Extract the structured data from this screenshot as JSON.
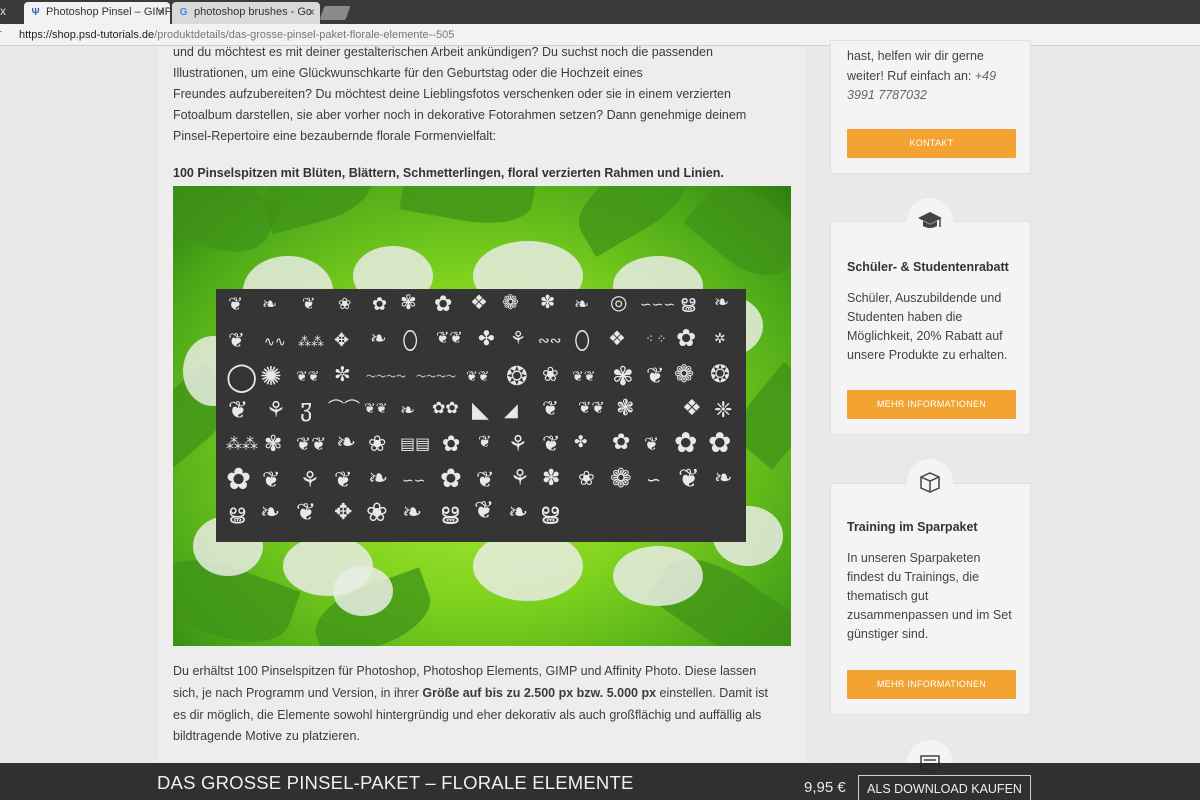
{
  "browser": {
    "tabs": [
      {
        "title": "Photoshop Pinsel – GIMP",
        "favicon": "psd-tutorials-favicon"
      },
      {
        "title": "photoshop brushes - Go",
        "favicon": "google-favicon"
      }
    ],
    "url_host": "https://shop.psd-tutorials.de",
    "url_path": "/produktdetails/das-grosse-pinsel-paket-florale-elemente--505"
  },
  "intro": {
    "line1": "und du möchtest es mit deiner gestalterischen Arbeit ankündigen? Du suchst noch die passenden",
    "line2": "Illustrationen, um eine Glückwunschkarte für den Geburtstag oder die Hochzeit eines",
    "line3": "Freundes aufzubereiten? Du möchtest deine Lieblingsfotos verschenken oder sie in einem verzierten",
    "line4": "Fotoalbum darstellen, sie aber vorher noch in dekorative Fotorahmen setzen? Dann genehmige deinem",
    "line5": "Pinsel-Repertoire eine bezaubernde florale Formenvielfalt:"
  },
  "highlight": "100 Pinselspitzen mit Blüten, Blättern, Schmetterlingen, floral verzierten Rahmen und Linien.",
  "description": {
    "line1": "Du erhältst 100 Pinselspitzen für Photoshop, Photoshop Elements, GIMP und Affinity Photo. Diese lassen",
    "line2_pre": "sich, je nach Programm und Version, in ihrer ",
    "line2_bold": "Größe auf bis zu 2.500 px bzw. 5.000 px",
    "line2_post": " einstellen. Damit ist",
    "line3": "es dir möglich, die Elemente sowohl hintergründig und eher dekorativ als auch großflächig und auffällig als",
    "line4": "bildtragende Motive zu platzieren."
  },
  "sidebar": {
    "contact": {
      "text1": "hast, helfen wir dir gerne",
      "text2": "weiter! Ruf einfach an:",
      "phone1": "+49",
      "phone2": "3991 7787032",
      "button": "KONTAKT"
    },
    "students": {
      "icon": "graduation-cap-icon",
      "title": "Schüler- & Studentenrabatt",
      "text": [
        "Schüler, Auszubildende und",
        "Studenten haben die",
        "Möglichkeit, 20% Rabatt auf",
        "unsere Produkte zu erhalten."
      ],
      "button": "MEHR INFORMATIONEN"
    },
    "bundle": {
      "icon": "box-icon",
      "title": "Training im Sparpaket",
      "text": [
        "In unseren Sparpaketen",
        "findest du Trainings, die",
        "thematisch gut",
        "zusammenpassen und im Set",
        "günstiger sind."
      ],
      "button": "MEHR INFORMATIONEN"
    },
    "next_icon": "list-icon"
  },
  "sticky": {
    "title": "DAS GROSSE PINSEL-PAKET – FLORALE ELEMENTE",
    "price": "9,95 €",
    "button": "ALS DOWNLOAD KAUFEN"
  },
  "colors": {
    "accent": "#f2a332",
    "sticky_bg": "#282828"
  }
}
